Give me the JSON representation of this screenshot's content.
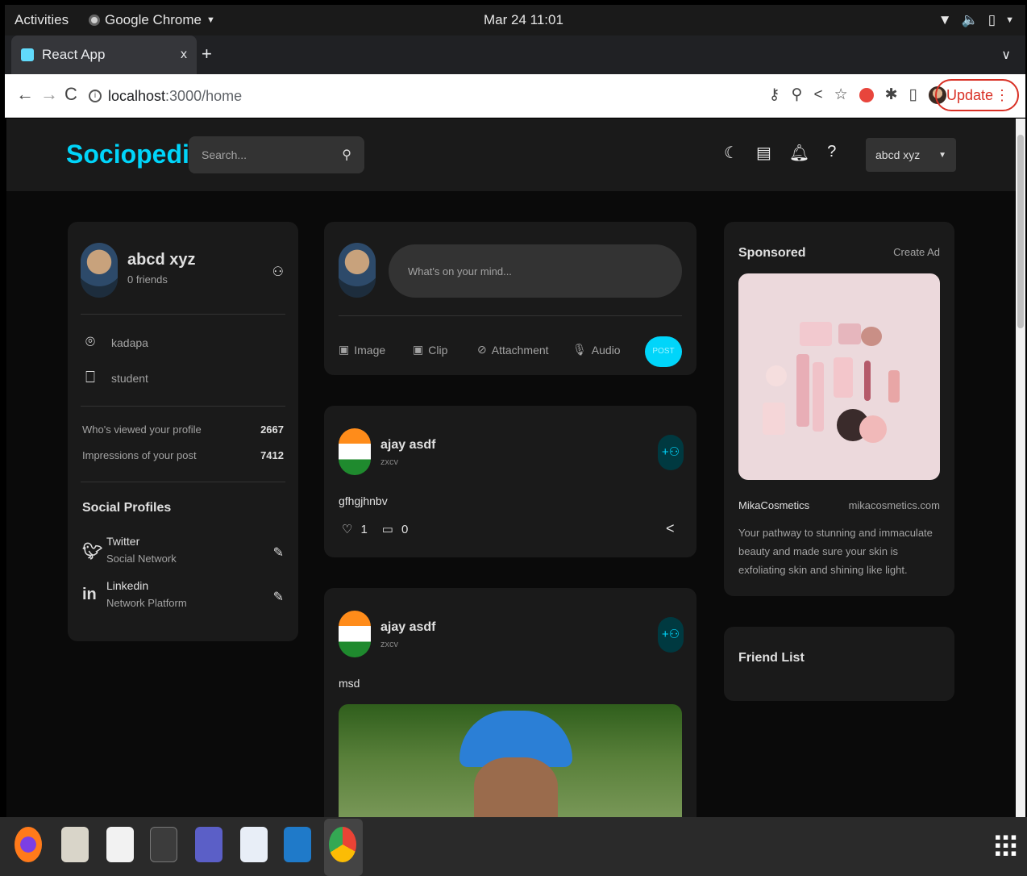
{
  "system": {
    "activities": "Activities",
    "app_name": "Google Chrome",
    "clock": "Mar 24  11:01"
  },
  "browser": {
    "tab_title": "React App",
    "tab_close": "x",
    "new_tab": "+",
    "url_host": "localhost",
    "url_path": ":3000/home",
    "update_label": "Update"
  },
  "app": {
    "logo": "Sociopedia",
    "search_placeholder": "Search...",
    "user_menu": "abcd xyz",
    "accent_color": "#00d5fa"
  },
  "user_widget": {
    "name": "abcd xyz",
    "friends": "0 friends",
    "location": "kadapa",
    "occupation": "student",
    "profile_views_label": "Who's viewed your profile",
    "profile_views": "2667",
    "impressions_label": "Impressions of your post",
    "impressions": "7412",
    "social_title": "Social Profiles",
    "socials": [
      {
        "name": "Twitter",
        "type": "Social Network"
      },
      {
        "name": "Linkedin",
        "type": "Network Platform"
      }
    ]
  },
  "composer": {
    "placeholder": "What's on your mind...",
    "actions": [
      "Image",
      "Clip",
      "Attachment",
      "Audio"
    ],
    "post_label": "POST"
  },
  "posts": [
    {
      "name": "ajay asdf",
      "location": "zxcv",
      "description": "gfhgjhnbv",
      "likes": "1",
      "comments": "0"
    },
    {
      "name": "ajay asdf",
      "location": "zxcv",
      "description": "msd"
    }
  ],
  "sponsored": {
    "title": "Sponsored",
    "create_ad": "Create Ad",
    "brand": "MikaCosmetics",
    "site": "mikacosmetics.com",
    "description": "Your pathway to stunning and immaculate beauty and made sure your skin is exfoliating skin and shining like light."
  },
  "friend_list": {
    "title": "Friend List"
  }
}
